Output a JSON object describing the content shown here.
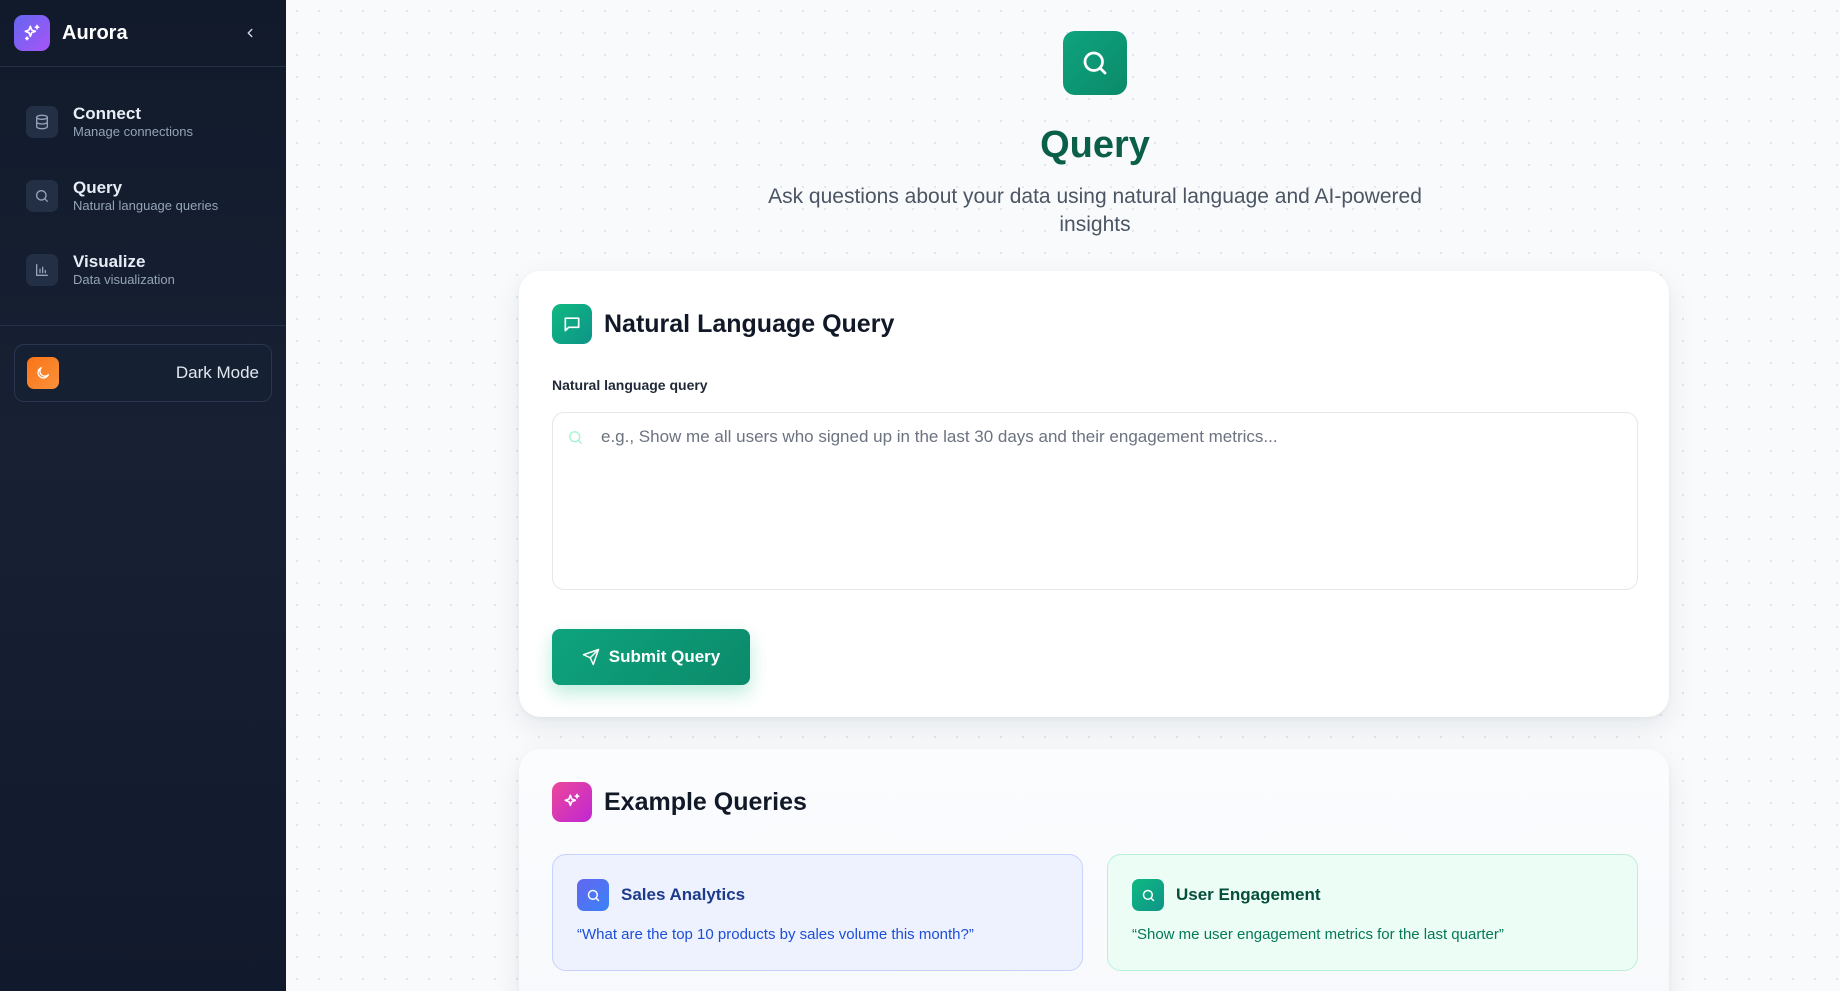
{
  "app": {
    "name": "Aurora"
  },
  "sidebar": {
    "items": [
      {
        "label": "Connect",
        "sub": "Manage connections",
        "icon": "database-icon"
      },
      {
        "label": "Query",
        "sub": "Natural language queries",
        "icon": "search-icon"
      },
      {
        "label": "Visualize",
        "sub": "Data visualization",
        "icon": "bar-chart-icon"
      }
    ],
    "dark_mode_label": "Dark Mode"
  },
  "header": {
    "title": "Query",
    "subtitle": "Ask questions about your data using natural language and AI-powered insights"
  },
  "query_card": {
    "title": "Natural Language Query",
    "field_label": "Natural language query",
    "placeholder": "e.g., Show me all users who signed up in the last 30 days and their engagement metrics...",
    "value": "",
    "submit_label": "Submit Query"
  },
  "examples": {
    "title": "Example Queries",
    "items": [
      {
        "title": "Sales Analytics",
        "text": "“What are the top 10 products by sales volume this month?”"
      },
      {
        "title": "User Engagement",
        "text": "“Show me user engagement metrics for the last quarter”"
      }
    ]
  },
  "colors": {
    "accent": "#0ea47d",
    "sidebar_bg": "#111a2b",
    "title_green": "#0b5e48"
  }
}
